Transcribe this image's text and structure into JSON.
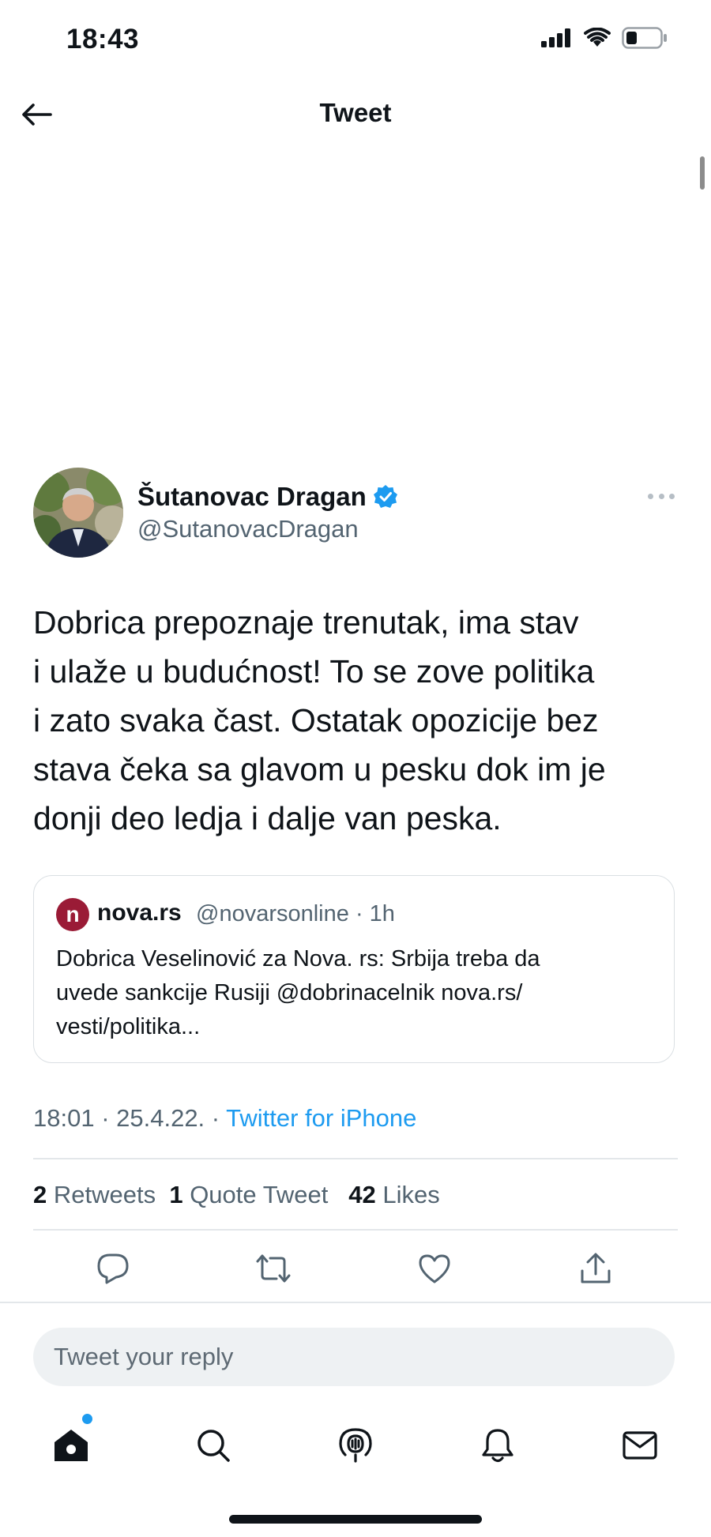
{
  "status_bar": {
    "time": "18:43"
  },
  "header": {
    "title": "Tweet"
  },
  "tweet": {
    "author_name": "Šutanovac Dragan",
    "author_handle": "@SutanovacDragan",
    "verified": true,
    "text": "Dobrica prepoznaje trenutak, ima stav\ni ulaže u budućnost! To se zove politika\ni zato svaka čast. Ostatak opozicije bez\nstava čeka sa glavom u pesku dok im je\ndonji deo ledja i dalje van peska.",
    "quote": {
      "logo_letter": "n",
      "name": "nova.rs",
      "handle_time": "@novarsonline · 1h",
      "text": "Dobrica Veselinović za Nova. rs: Srbija treba da\nuvede sankcije Rusiji @dobrinacelnik  nova.rs/\nvesti/politika..."
    },
    "time_date": "18:01 · 25.4.22. · ",
    "source": "Twitter for iPhone",
    "stats": {
      "retweets_count": "2",
      "retweets_label": " Retweets",
      "quotes_count": "1",
      "quotes_label": " Quote Tweet",
      "likes_count": "42",
      "likes_label": " Likes"
    }
  },
  "reply": {
    "placeholder": "Tweet your reply"
  },
  "colors": {
    "accent": "#1d9bf0",
    "text": "#0f1419",
    "secondary": "#536471"
  },
  "tab_bar": {
    "items": [
      "home-icon",
      "search-icon",
      "spaces-icon",
      "notifications-icon",
      "messages-icon"
    ],
    "home_has_notification_dot": true
  }
}
